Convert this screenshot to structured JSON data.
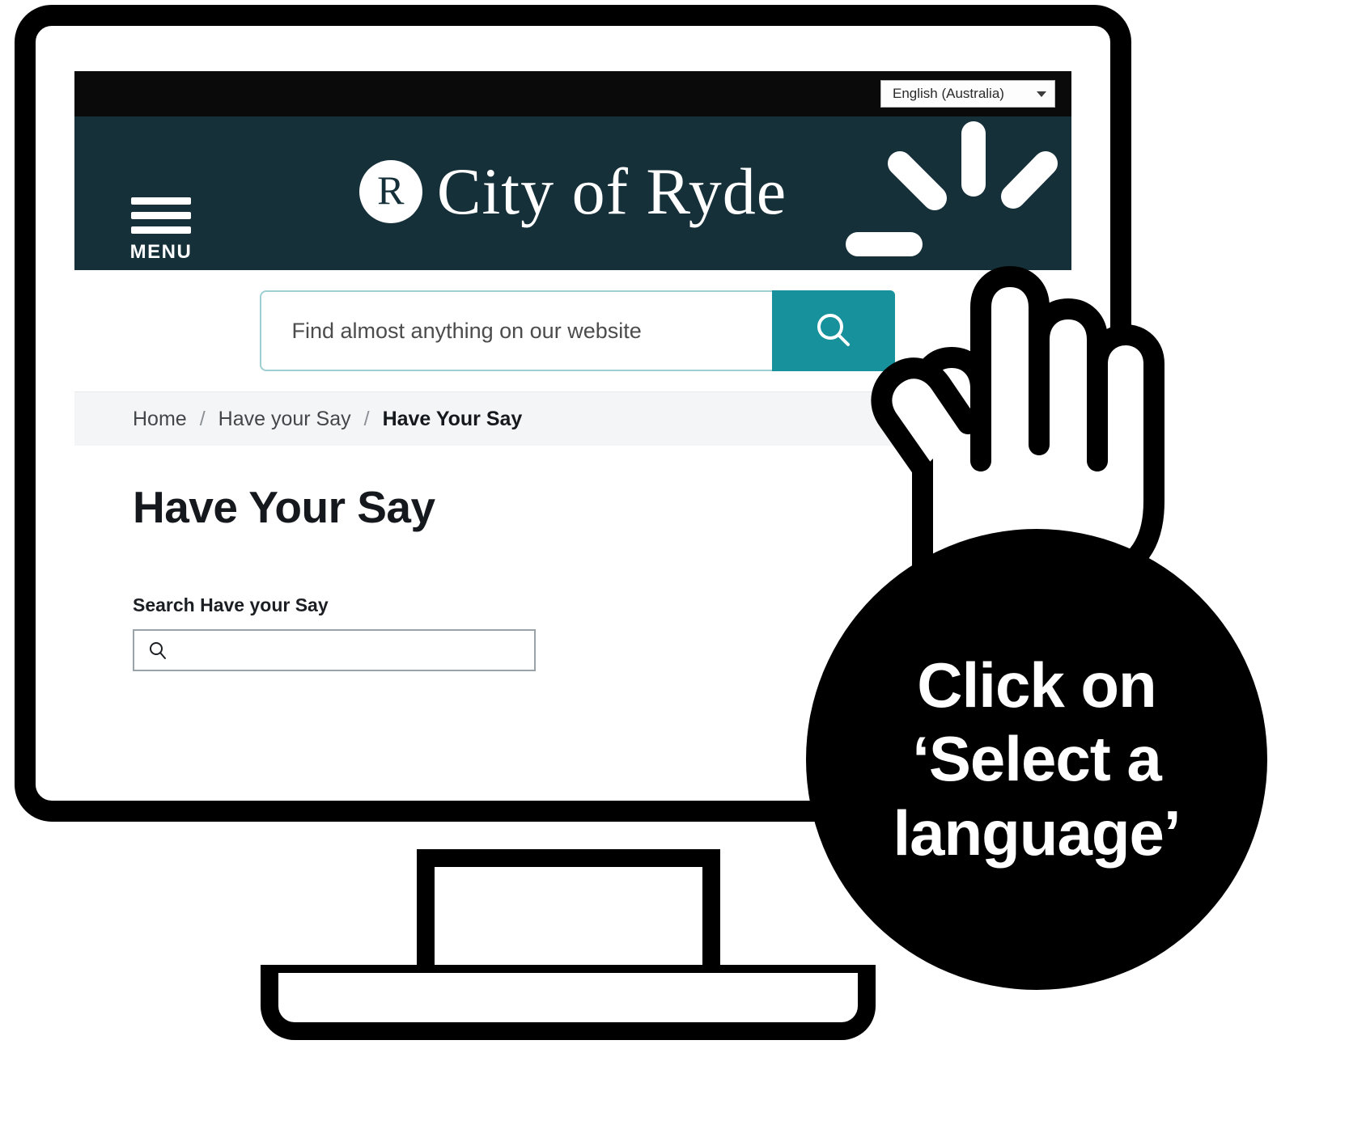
{
  "device": {
    "type": "desktop-monitor-illustration"
  },
  "browser": {
    "utility_bar": {
      "language_selector": {
        "label": "English (Australia)",
        "caret_icon": "chevron-down-icon"
      }
    },
    "header": {
      "menu_label": "MENU",
      "menu_icon": "hamburger-icon",
      "logo_mark_letter": "R",
      "site_name": "City of Ryde"
    },
    "site_search": {
      "placeholder": "Find almost anything on our website",
      "value": "",
      "button_icon": "search-icon"
    },
    "breadcrumb": [
      {
        "label": "Home",
        "current": false
      },
      {
        "label": "Have your Say",
        "current": false
      },
      {
        "label": "Have Your Say",
        "current": true
      }
    ],
    "breadcrumb_separator": "/",
    "page": {
      "title": "Have Your Say",
      "search_label": "Search Have your Say",
      "search_placeholder": "",
      "search_value": "",
      "search_icon": "search-icon"
    }
  },
  "annotation": {
    "cursor_icon": "pointing-hand-cursor",
    "click_rays_icon": "click-burst-icon",
    "callout_text": "Click on ‘Select a language’"
  },
  "colors": {
    "utility_bar": "#0a0a0a",
    "header": "#16303a",
    "search_button": "#17919b",
    "search_border": "#9fcfd2",
    "breadcrumb_bg": "#f4f5f6",
    "callout_bg": "#000000",
    "text_dark": "#15191d"
  }
}
